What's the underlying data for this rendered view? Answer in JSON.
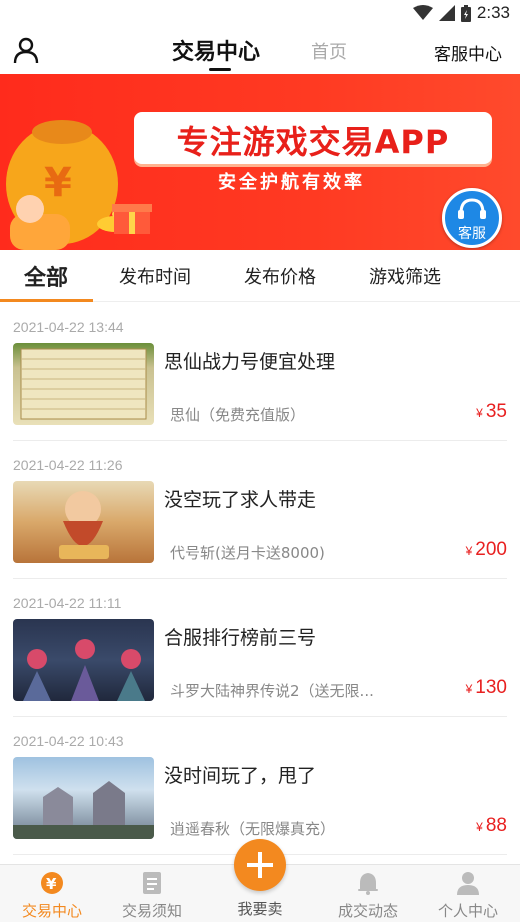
{
  "status_bar": {
    "time": "2:33"
  },
  "header": {
    "active_tab": "交易中心",
    "inactive_tab": "首页",
    "service_link": "客服中心"
  },
  "banner": {
    "title": "专注游戏交易APP",
    "subtitle": "安全护航有效率",
    "service_button": "客服",
    "colors": {
      "background": "#ff2b1c",
      "title_text": "#e8201a",
      "service_button": "#1e88e5"
    }
  },
  "filters": {
    "items": [
      "全部",
      "发布时间",
      "发布价格",
      "游戏筛选"
    ],
    "active_index": 0
  },
  "currency_symbol": "¥",
  "listings": [
    {
      "date": "2021-04-22 13:44",
      "title": "思仙战力号便宜处理",
      "game": "思仙（免费充值版）",
      "price": "35"
    },
    {
      "date": "2021-04-22 11:26",
      "title": "没空玩了求人带走",
      "game": "代号斩(送月卡送8000)",
      "price": "200"
    },
    {
      "date": "2021-04-22 11:11",
      "title": "合服排行榜前三号",
      "game": "斗罗大陆神界传说2（送无限...",
      "price": "130"
    },
    {
      "date": "2021-04-22 10:43",
      "title": "没时间玩了，甩了",
      "game": "逍遥春秋（无限爆真充）",
      "price": "88"
    }
  ],
  "bottom_nav": {
    "items": [
      {
        "label": "交易中心",
        "icon": "yen-coin-icon"
      },
      {
        "label": "交易须知",
        "icon": "document-icon"
      },
      {
        "label": "成交动态",
        "icon": "bell-icon"
      },
      {
        "label": "个人中心",
        "icon": "person-icon"
      }
    ],
    "sell_label": "我要卖",
    "active_index": 0
  },
  "colors": {
    "accent": "#f3891f",
    "price": "#e82020"
  }
}
